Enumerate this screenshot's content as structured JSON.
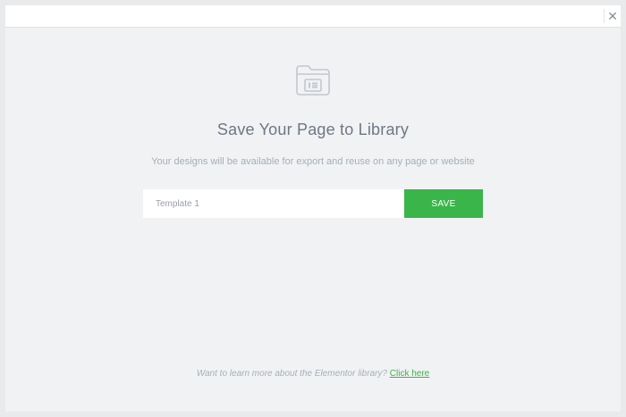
{
  "header": {
    "close_icon": "close-icon"
  },
  "main": {
    "icon": "folder-library-icon",
    "title": "Save Your Page to Library",
    "subtitle": "Your designs will be available for export and reuse on any page or website",
    "input": {
      "value": "",
      "placeholder": "Template 1"
    },
    "save_label": "SAVE"
  },
  "footer": {
    "message": "Want to learn more about the Elementor library?",
    "link_label": "Click here"
  },
  "colors": {
    "accent": "#39b54a",
    "background": "#f1f2f4"
  }
}
